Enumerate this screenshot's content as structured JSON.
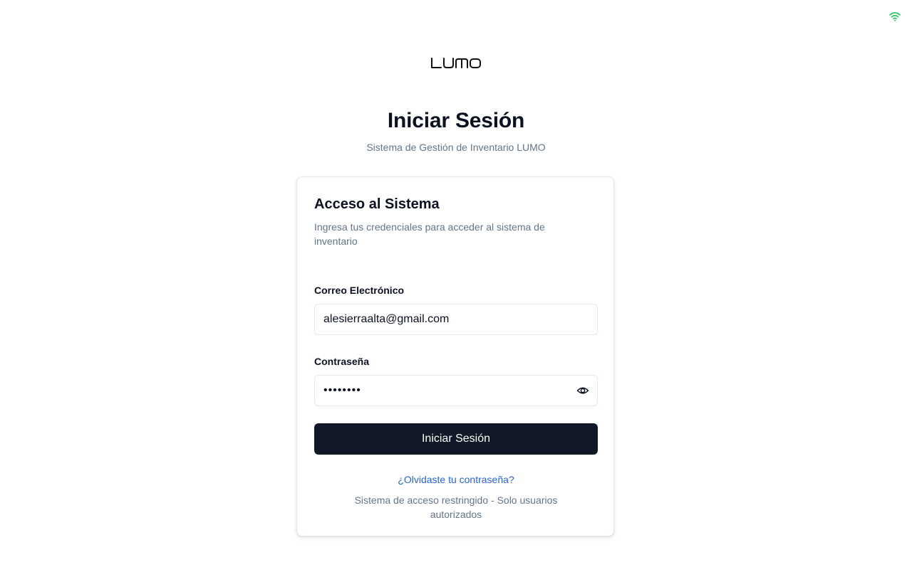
{
  "status": {
    "icon": "wifi-icon",
    "color": "#22c55e"
  },
  "brand": {
    "logo_text": "LUMO"
  },
  "header": {
    "title": "Iniciar Sesión",
    "subtitle": "Sistema de Gestión de Inventario LUMO"
  },
  "card": {
    "title": "Acceso al Sistema",
    "description": "Ingresa tus credenciales para acceder al sistema de inventario",
    "email": {
      "label": "Correo Electrónico",
      "value": "alesierraalta@gmail.com"
    },
    "password": {
      "label": "Contraseña",
      "value": "••••••••",
      "toggle_icon": "eye-icon"
    },
    "submit_label": "Iniciar Sesión",
    "forgot_link": "¿Olvidaste tu contraseña?",
    "footer_note": "Sistema de acceso restringido - Solo usuarios autorizados"
  },
  "colors": {
    "primary_button": "#111827",
    "link": "#2563eb",
    "muted_text": "#64748b"
  }
}
